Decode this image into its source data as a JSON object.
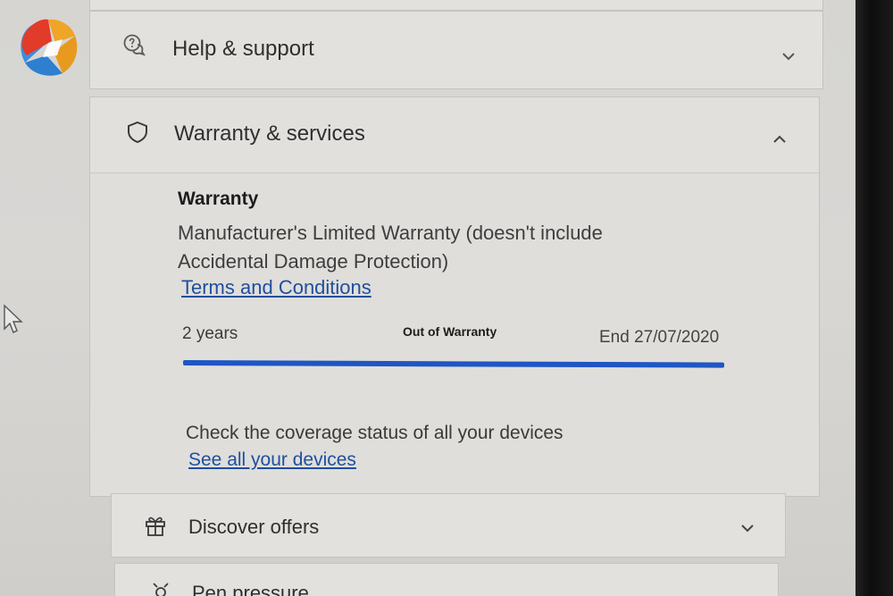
{
  "sections": {
    "help": {
      "label": "Help & support",
      "icon": "chat-help-icon",
      "expanded": false
    },
    "warranty": {
      "label": "Warranty & services",
      "icon": "shield-icon",
      "expanded": true,
      "title": "Warranty",
      "description": "Manufacturer's Limited Warranty (doesn't include Accidental Damage Protection)",
      "terms_link": "Terms and Conditions",
      "duration": "2 years",
      "status": "Out of Warranty",
      "end_date": "End 27/07/2020",
      "progress": 1.0,
      "coverage_text": "Check the coverage status of all your devices",
      "devices_link": "See all your devices"
    },
    "offers": {
      "label": "Discover offers",
      "icon": "gift-icon",
      "expanded": false
    },
    "pen": {
      "label": "Pen pressure",
      "icon": "pen-icon"
    }
  },
  "colors": {
    "accent": "#1f56c4",
    "link": "#1f4f9e"
  }
}
